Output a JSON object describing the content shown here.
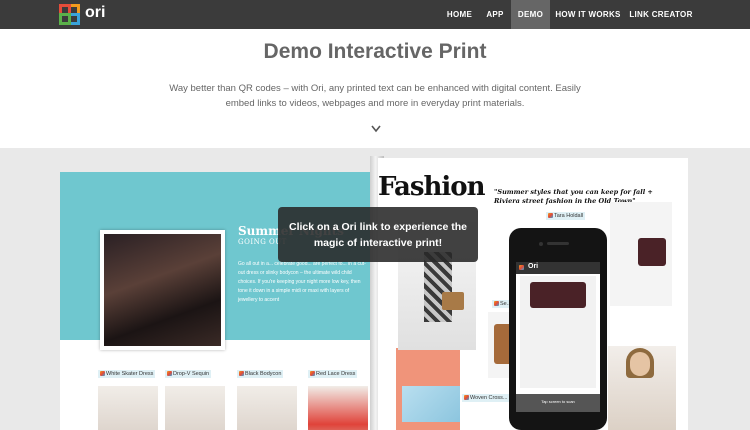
{
  "brand": {
    "name": "ori"
  },
  "nav": {
    "items": [
      {
        "label": "HOME",
        "active": false
      },
      {
        "label": "APP",
        "active": false
      },
      {
        "label": "DEMO",
        "active": true
      },
      {
        "label": "HOW IT WORKS",
        "active": false
      },
      {
        "label": "LINK CREATOR",
        "active": false
      }
    ]
  },
  "hero": {
    "title": "Demo Interactive Print",
    "description": "Way better than QR codes – with Ori, any printed text can be enhanced with digital content. Easily embed links to videos, webpages and more in everyday print materials."
  },
  "magazine": {
    "left": {
      "article_title": "Summer Nights",
      "article_subtitle": "GOING OUT",
      "article_body": "Go all out in a... celebrate good... are perfect fo... in a cut-out dress or slinky bodycon – the ultimate wild child choices. If you're keeping your night more low key, then tone it down in a simple midi or maxi with layers of jewellery to accent",
      "products": [
        {
          "label": "White Skater Dress"
        },
        {
          "label": "Drop-V Sequin"
        },
        {
          "label": "Black Bodycon"
        },
        {
          "label": "Red Lace Dress"
        }
      ]
    },
    "right": {
      "heading": "Fashion",
      "quote": "\"Summer styles that you can keep for fall + Riviera street fashion in the Old Town\"",
      "tags": {
        "tara_holdall": "Tara Holdall",
        "satchel": "Se... Satchel",
        "woven": "Woven Cross... Body Bag"
      }
    }
  },
  "phone": {
    "app_name": "Ori",
    "scan_text": "Tap screen to scan"
  },
  "overlay": {
    "text": "Click on a Ori link to experience the magic of interactive print!"
  },
  "colors": {
    "nav_bg": "#3b3b3b",
    "nav_active": "#666666",
    "teal": "#6fc7cf",
    "salmon": "#f0947a"
  },
  "icons": [
    "ori-logo-icon",
    "chevron-down-icon",
    "ori-tag-icon"
  ]
}
